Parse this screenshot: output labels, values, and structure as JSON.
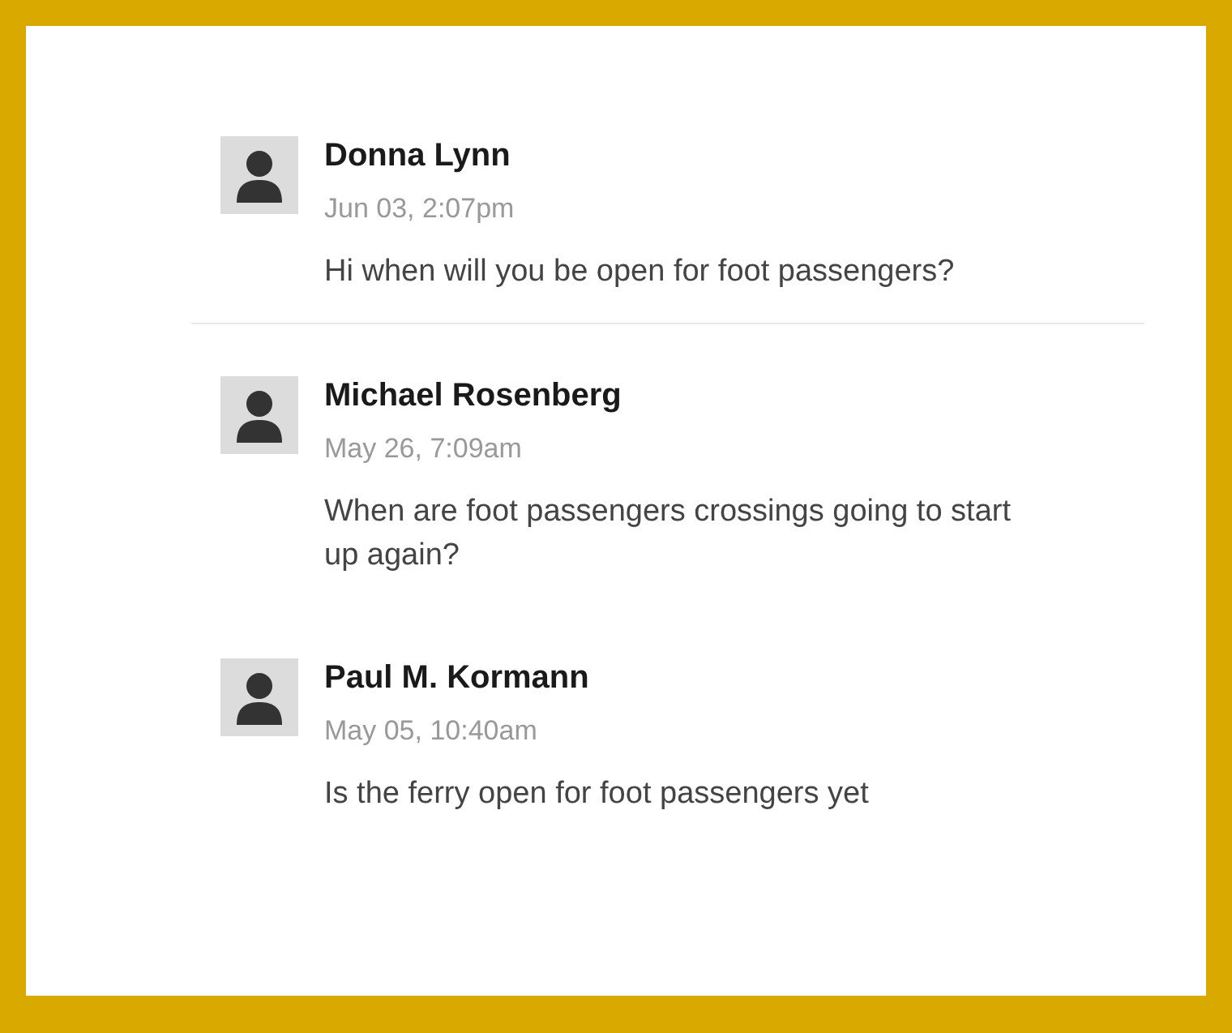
{
  "comments": [
    {
      "author": "Donna Lynn",
      "date": "Jun 03, 2:07pm",
      "text": "Hi when will you be open for foot passengers?",
      "divider_below": true
    },
    {
      "author": "Michael Rosenberg",
      "date": "May 26, 7:09am",
      "text": "When are foot passengers crossings going to start up again?",
      "divider_below": false
    },
    {
      "author": "Paul M. Kormann",
      "date": "May 05, 10:40am",
      "text": "Is the ferry open for foot passengers yet",
      "divider_below": false
    }
  ]
}
